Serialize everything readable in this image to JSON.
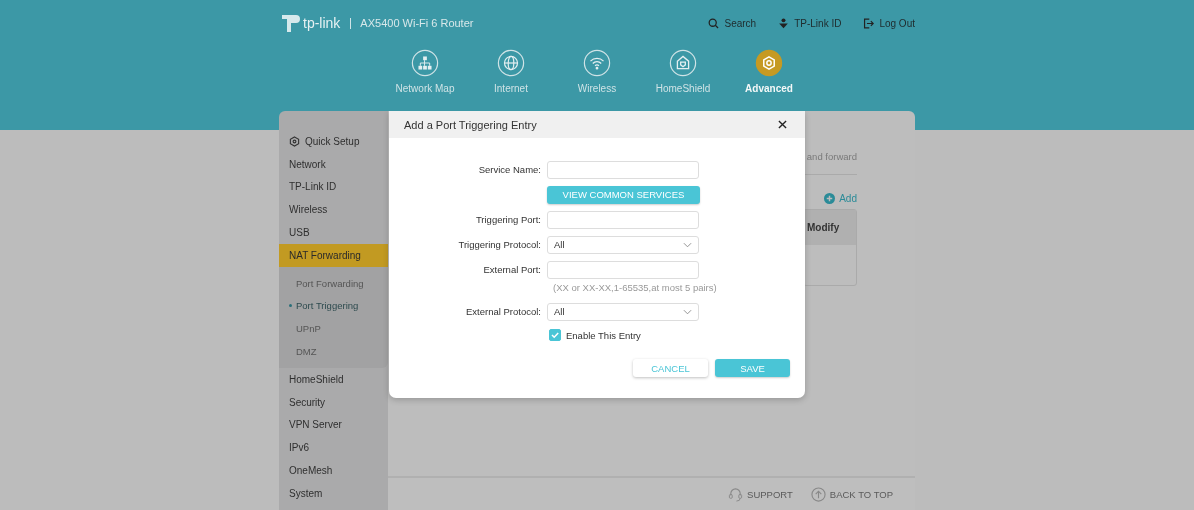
{
  "header": {
    "logo": "tp-link",
    "model": "AX5400 Wi-Fi 6 Router",
    "links": [
      {
        "kind": "search",
        "label": "Search"
      },
      {
        "kind": "id",
        "label": "TP-Link ID"
      },
      {
        "kind": "logout",
        "label": "Log Out"
      }
    ]
  },
  "nav": [
    {
      "kind": "map",
      "label": "Network Map",
      "selected": false
    },
    {
      "kind": "globe",
      "label": "Internet",
      "selected": false
    },
    {
      "kind": "wifi",
      "label": "Wireless",
      "selected": false
    },
    {
      "kind": "shield",
      "label": "HomeShield",
      "selected": false
    },
    {
      "kind": "gear",
      "label": "Advanced",
      "selected": true
    }
  ],
  "sidebar": {
    "items": [
      {
        "kind": "setup",
        "label": "Quick Setup",
        "selected": false
      },
      {
        "kind": "link",
        "label": "Network",
        "selected": false
      },
      {
        "kind": "link",
        "label": "TP-Link ID",
        "selected": false
      },
      {
        "kind": "link",
        "label": "Wireless",
        "selected": false
      },
      {
        "kind": "link",
        "label": "USB",
        "selected": false
      },
      {
        "kind": "link",
        "label": "NAT Forwarding",
        "selected": true,
        "children": [
          {
            "label": "Port Forwarding",
            "selected": false
          },
          {
            "label": "Port Triggering",
            "selected": true
          },
          {
            "label": "UPnP",
            "selected": false
          },
          {
            "label": "DMZ",
            "selected": false
          }
        ]
      },
      {
        "kind": "link",
        "label": "HomeShield",
        "selected": false
      },
      {
        "kind": "link",
        "label": "Security",
        "selected": false
      },
      {
        "kind": "link",
        "label": "VPN Server",
        "selected": false
      },
      {
        "kind": "link",
        "label": "IPv6",
        "selected": false
      },
      {
        "kind": "link",
        "label": "OneMesh",
        "selected": false
      },
      {
        "kind": "link",
        "label": "System",
        "selected": false
      }
    ]
  },
  "content": {
    "description": "and forward",
    "add_button": "Add",
    "table": {
      "columns": [
        "Modify"
      ]
    }
  },
  "footer": {
    "support": "SUPPORT",
    "back_to_top": "BACK TO TOP"
  },
  "dialog": {
    "title": "Add a Port Triggering Entry",
    "rows": [
      {
        "kind": "text",
        "label": "Service Name:"
      },
      {
        "kind": "button",
        "label": "VIEW COMMON SERVICES"
      },
      {
        "kind": "text",
        "label": "Triggering Port:"
      },
      {
        "kind": "select",
        "label": "Triggering Protocol:",
        "value": "All"
      },
      {
        "kind": "text",
        "label": "External Port:"
      },
      {
        "kind": "hint",
        "label": "(XX or XX-XX,1-65535,at most 5 pairs)"
      },
      {
        "kind": "select",
        "label": "External Protocol:",
        "value": "All"
      },
      {
        "kind": "checkbox",
        "label": "Enable This Entry",
        "checked": true
      }
    ],
    "buttons": [
      {
        "kind": "secondary",
        "label": "CANCEL"
      },
      {
        "kind": "primary",
        "label": "SAVE"
      }
    ]
  }
}
